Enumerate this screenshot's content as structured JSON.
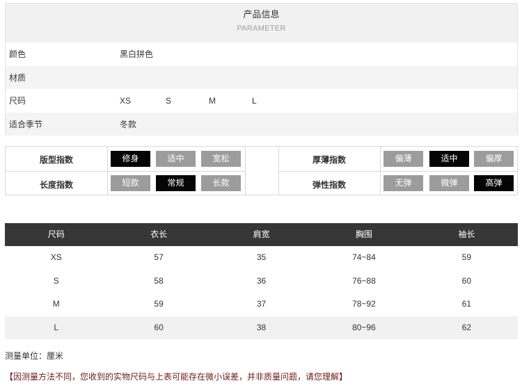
{
  "params": {
    "title_zh": "产品信息",
    "title_en": "PARAMETER",
    "rows": [
      {
        "label": "颜色",
        "value": "黑白拼色"
      },
      {
        "label": "材质",
        "value": ""
      },
      {
        "label": "尺码",
        "sizes": [
          "XS",
          "S",
          "M",
          "L"
        ]
      },
      {
        "label": "适合季节",
        "value": "冬款"
      }
    ]
  },
  "indices": {
    "fit": {
      "label": "版型指数",
      "options": [
        "修身",
        "适中",
        "宽松"
      ],
      "selected": 0
    },
    "length": {
      "label": "长度指数",
      "options": [
        "短款",
        "常规",
        "长款"
      ],
      "selected": 1
    },
    "thickness": {
      "label": "厚薄指数",
      "options": [
        "偏薄",
        "适中",
        "偏厚"
      ],
      "selected": 1
    },
    "elasticity": {
      "label": "弹性指数",
      "options": [
        "无弹",
        "微弹",
        "高弹"
      ],
      "selected": 2
    }
  },
  "size_table": {
    "headers": [
      "尺码",
      "衣长",
      "肩宽",
      "胸围",
      "袖长"
    ],
    "rows": [
      [
        "XS",
        "57",
        "35",
        "74~84",
        "59"
      ],
      [
        "S",
        "58",
        "36",
        "76~88",
        "60"
      ],
      [
        "M",
        "59",
        "37",
        "78~92",
        "61"
      ],
      [
        "L",
        "60",
        "38",
        "80~96",
        "62"
      ]
    ]
  },
  "unit_note": "测量单位：厘米",
  "disclaimer": "【因测量方法不同，您收到的实物尺码与上表可能存在微小误差，并非质量问题，请您理解】",
  "colors": {
    "chip_on": "#050505",
    "chip_off": "#9c9c9c",
    "table_header": "#363636",
    "disclaimer": "#6b1a1a"
  }
}
